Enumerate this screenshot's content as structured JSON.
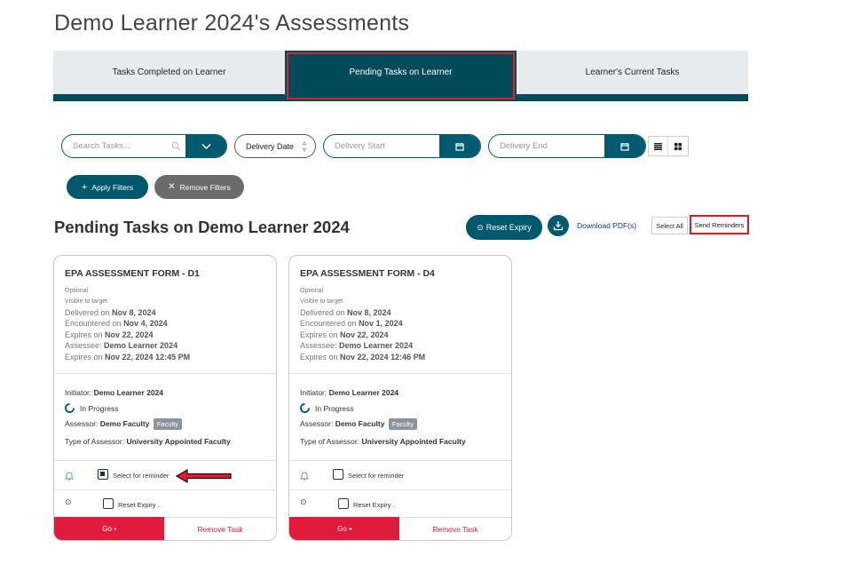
{
  "page": {
    "title": "Demo Learner 2024's Assessments"
  },
  "tabs": [
    {
      "label": "Tasks Completed on Learner"
    },
    {
      "label": "Pending Tasks on Learner"
    },
    {
      "label": "Learner's Current Tasks"
    }
  ],
  "filters": {
    "search_placeholder": "Search Tasks...",
    "sort_value": "Delivery Date",
    "delivery_start_placeholder": "Delivery Start",
    "delivery_end_placeholder": "Delivery End",
    "apply_label": "Apply Filters",
    "remove_label": "Remove Filters"
  },
  "section": {
    "title": "Pending Tasks on Demo Learner 2024",
    "reset_expiry_label": "Reset Expiry",
    "download_label": "Download PDF(s)",
    "select_all_label": "Select All",
    "send_reminders_label": "Send Reminders"
  },
  "cards": [
    {
      "title": "EPA ASSESSMENT FORM - D1",
      "optional": "Optional",
      "visible": "Visible to target",
      "delivered_label": "Delivered on ",
      "delivered": "Nov 8, 2024",
      "encountered_label": "Encountered on ",
      "encountered": "Nov 4, 2024",
      "expires_label": "Expires on ",
      "expires": "Nov 22, 2024",
      "assessee_label": "Assessee: ",
      "assessee": "Demo Learner 2024",
      "expires2_label": "Expires on ",
      "expires2": "Nov 22, 2024 12:45 PM",
      "initiator_label": "Initiator: ",
      "initiator": "Demo Learner 2024",
      "status": "In Progress",
      "assessor_label": "Assessor: ",
      "assessor": "Demo Faculty",
      "assessor_badge": "Faculty",
      "type_label": "Type of Assessor: ",
      "type": "University Appointed Faculty",
      "reminder_label": "Select for reminder",
      "reset_label": "Reset Expiry .",
      "go_label": "Go",
      "remove_label": "Remove Task"
    },
    {
      "title": "EPA ASSESSMENT FORM - D4",
      "optional": "Optional",
      "visible": "Visible to target",
      "delivered_label": "Delivered on ",
      "delivered": "Nov 8, 2024",
      "encountered_label": "Encountered on ",
      "encountered": "Nov 1, 2024",
      "expires_label": "Expires on ",
      "expires": "Nov 22, 2024",
      "assessee_label": "Assessee: ",
      "assessee": "Demo Learner 2024",
      "expires2_label": "Expires on ",
      "expires2": "Nov 22, 2024 12:46 PM",
      "initiator_label": "Initiator: ",
      "initiator": "Demo Learner 2024",
      "status": "In Progress",
      "assessor_label": "Assessor: ",
      "assessor": "Demo Faculty",
      "assessor_badge": "Faculty",
      "type_label": "Type of Assessor: ",
      "type": "University Appointed Faculty",
      "reminder_label": "Select for reminder",
      "reset_label": "Reset Expiry .",
      "go_label": "Go",
      "remove_label": "Remove Task"
    }
  ],
  "colors": {
    "primary": "#005a70",
    "danger": "#e11b3b",
    "highlight": "#d61c2a"
  },
  "icons": [
    "search-icon",
    "chevron-down-icon",
    "calendar-icon",
    "list-view-icon",
    "grid-view-icon",
    "plus-icon",
    "close-icon",
    "clock-icon",
    "download-icon",
    "bell-icon",
    "spinner-icon",
    "arrow-left-icon"
  ]
}
